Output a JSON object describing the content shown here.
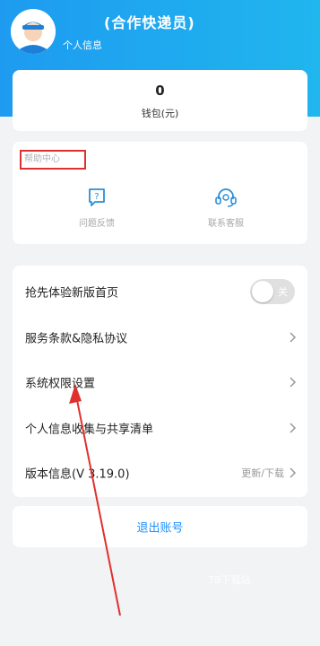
{
  "header": {
    "user_name": "(合作快递员)",
    "subtitle": "个人信息"
  },
  "wallet": {
    "amount": "0",
    "label": "钱包(元)"
  },
  "help_center": {
    "title": "帮助中心",
    "items": [
      {
        "label": "问题反馈",
        "icon": "feedback-icon"
      },
      {
        "label": "联系客服",
        "icon": "headset-icon"
      }
    ]
  },
  "settings": {
    "items": [
      {
        "label": "抢先体验新版首页",
        "control": "toggle",
        "toggle_text": "关",
        "toggle_on": false
      },
      {
        "label": "服务条款&隐私协议",
        "control": "chevron"
      },
      {
        "label": "系统权限设置",
        "control": "chevron"
      },
      {
        "label": "个人信息收集与共享清单",
        "control": "chevron"
      },
      {
        "label": "版本信息(V 3.19.0)",
        "control": "chevron",
        "right_text": "更新/下载"
      }
    ]
  },
  "logout": {
    "label": "退出账号"
  },
  "watermark": "7B下载站",
  "colors": {
    "header_gradient_start": "#1e9bf0",
    "header_gradient_end": "#20b6ee",
    "accent_link": "#1e90ff",
    "annotation_red": "#e0302e",
    "icon_blue": "#2a8fd8"
  }
}
